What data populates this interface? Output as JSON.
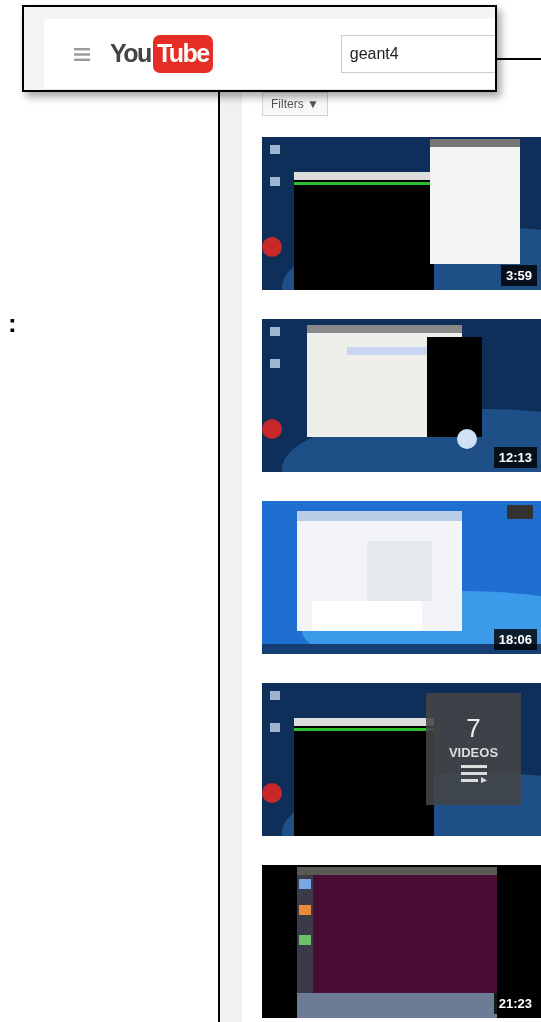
{
  "header": {
    "logo_text": "You",
    "logo_badge": "Tube",
    "search": {
      "value": "geant4"
    }
  },
  "side_mark": ":",
  "filters": {
    "label": "Filters",
    "caret": "▼"
  },
  "results": [
    {
      "kind": "video",
      "duration": "3:59"
    },
    {
      "kind": "video",
      "duration": "12:13"
    },
    {
      "kind": "video",
      "duration": "18:06"
    },
    {
      "kind": "playlist",
      "count": "7",
      "label": "VIDEOS"
    },
    {
      "kind": "video",
      "duration": "21:23"
    }
  ]
}
